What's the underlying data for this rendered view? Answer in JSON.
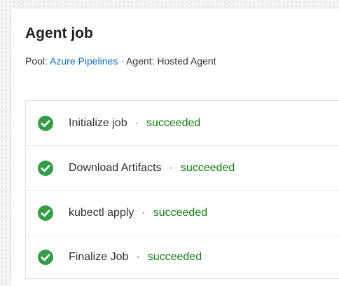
{
  "job": {
    "title": "Agent job",
    "pool_label": "Pool:",
    "pool_value": "Azure Pipelines",
    "separator": "·",
    "agent_label": "Agent:",
    "agent_value": "Hosted Agent"
  },
  "steps": [
    {
      "name": "Initialize job",
      "separator": "·",
      "status": "succeeded",
      "icon": "check-circle-icon"
    },
    {
      "name": "Download Artifacts",
      "separator": "·",
      "status": "succeeded",
      "icon": "check-circle-icon"
    },
    {
      "name": "kubectl apply",
      "separator": "·",
      "status": "succeeded",
      "icon": "check-circle-icon"
    },
    {
      "name": "Finalize Job",
      "separator": "·",
      "status": "succeeded",
      "icon": "check-circle-icon"
    }
  ],
  "colors": {
    "success": "#107c10",
    "success_icon": "#359d47",
    "link": "#106ebe",
    "text": "#323130"
  }
}
